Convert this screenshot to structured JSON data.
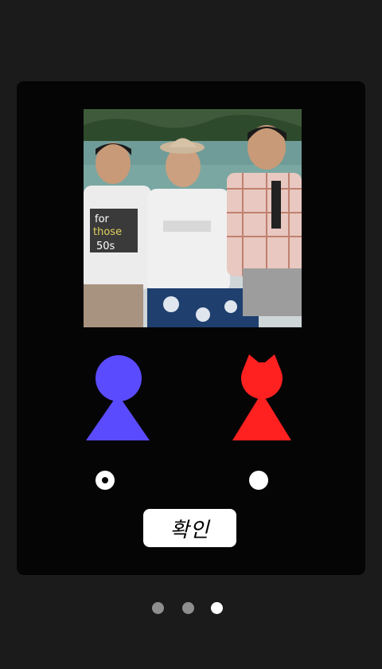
{
  "photo": {
    "description_icon": "group-photo-image"
  },
  "choices": [
    {
      "id": "male",
      "icon": "male-figure-icon",
      "color": "#5b4bff",
      "selected": true
    },
    {
      "id": "female",
      "icon": "female-figure-icon",
      "color": "#ff2020",
      "selected": false
    }
  ],
  "confirm": {
    "label": "확인"
  },
  "pager": {
    "count": 3,
    "active_index": 2
  }
}
